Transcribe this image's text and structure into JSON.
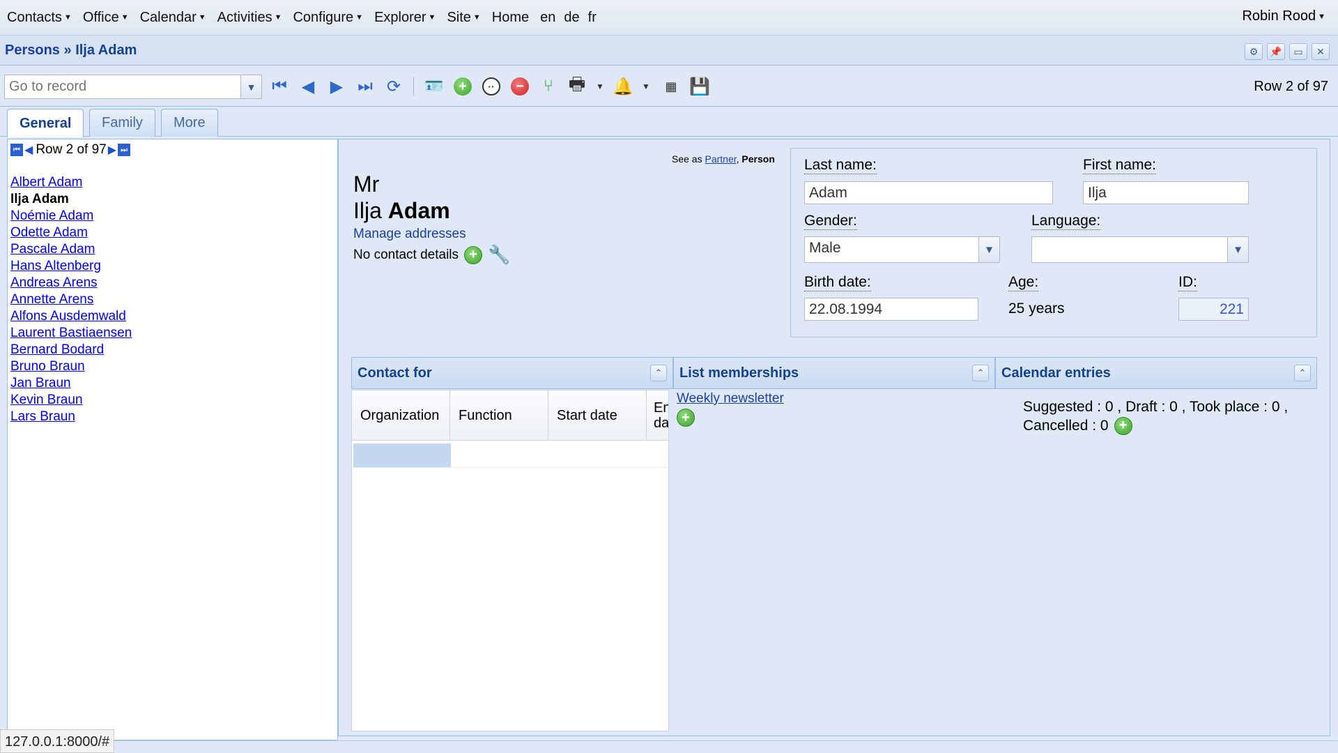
{
  "menu": {
    "items": [
      "Contacts",
      "Office",
      "Calendar",
      "Activities",
      "Configure",
      "Explorer",
      "Site"
    ],
    "plain": [
      "Home",
      "en",
      "de",
      "fr"
    ],
    "user": "Robin Rood"
  },
  "title": {
    "crumb": "Persons",
    "sep": " » ",
    "name": "Ilja Adam"
  },
  "toolbar": {
    "goto_placeholder": "Go to record",
    "row_info": "Row 2 of 97"
  },
  "tabs": [
    "General",
    "Family",
    "More"
  ],
  "list": {
    "pager_label": "Row 2 of 97",
    "persons": [
      "Albert Adam",
      "Ilja Adam",
      "Noémie Adam",
      "Odette Adam",
      "Pascale Adam",
      "Hans Altenberg",
      "Andreas Arens",
      "Annette Arens",
      "Alfons Ausdemwald",
      "Laurent Bastiaensen",
      "Bernard Bodard",
      "Bruno Braun",
      "Jan Braun",
      "Kevin Braun",
      "Lars Braun"
    ],
    "current_index": 1
  },
  "detail": {
    "see_as_prefix": "See as",
    "see_as_partner": "Partner",
    "see_as_sep": ",",
    "see_as_person": "Person",
    "salutation": "Mr",
    "first": "Ilja",
    "last": "Adam",
    "manage_addresses": "Manage addresses",
    "no_contact": "No contact details"
  },
  "form": {
    "last_name_label": "Last name:",
    "last_name": "Adam",
    "first_name_label": "First name:",
    "first_name": "Ilja",
    "gender_label": "Gender:",
    "gender": "Male",
    "language_label": "Language:",
    "language": "",
    "birth_label": "Birth date:",
    "birth": "22.08.1994",
    "age_label": "Age:",
    "age": "25 years",
    "id_label": "ID:",
    "id": "221"
  },
  "panels": {
    "contact_for": "Contact for",
    "list_memberships": "List memberships",
    "calendar_entries": "Calendar entries",
    "grid_cols": [
      "Organization",
      "Function",
      "Start date",
      "En\nda"
    ],
    "weekly": "Weekly newsletter",
    "cal_line1": "Suggested : 0 , Draft : 0 , Took place : 0 ,",
    "cal_line2": "Cancelled : 0"
  },
  "status_url": "127.0.0.1:8000/#"
}
